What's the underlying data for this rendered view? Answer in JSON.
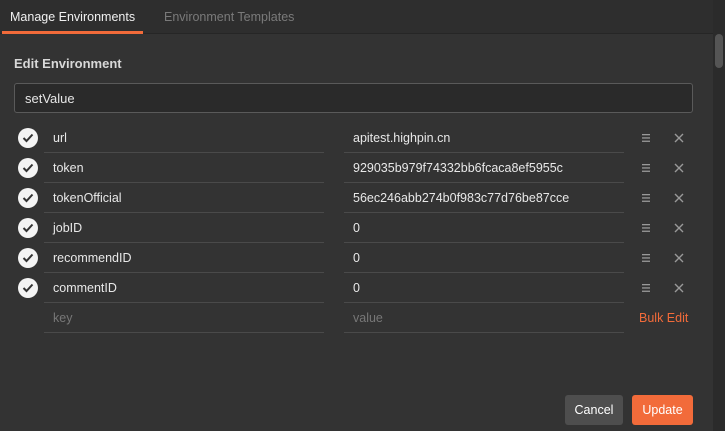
{
  "tabs": [
    {
      "label": "Manage Environments",
      "active": true
    },
    {
      "label": "Environment Templates",
      "active": false
    }
  ],
  "heading": "Edit Environment",
  "environment_name": "setValue",
  "variables": [
    {
      "key": "url",
      "value": "apitest.highpin.cn",
      "enabled": true
    },
    {
      "key": "token",
      "value": "929035b979f74332bb6fcaca8ef5955c",
      "enabled": true
    },
    {
      "key": "tokenOfficial",
      "value": "56ec246abb274b0f983c77d76be87cce",
      "enabled": true
    },
    {
      "key": "jobID",
      "value": "0",
      "enabled": true
    },
    {
      "key": "recommendID",
      "value": "0",
      "enabled": true
    },
    {
      "key": "commentID",
      "value": "0",
      "enabled": true
    }
  ],
  "new_row": {
    "key_placeholder": "key",
    "value_placeholder": "value"
  },
  "bulk_edit_label": "Bulk Edit",
  "buttons": {
    "cancel": "Cancel",
    "update": "Update"
  },
  "colors": {
    "accent": "#f26b3a",
    "background": "#333333"
  }
}
